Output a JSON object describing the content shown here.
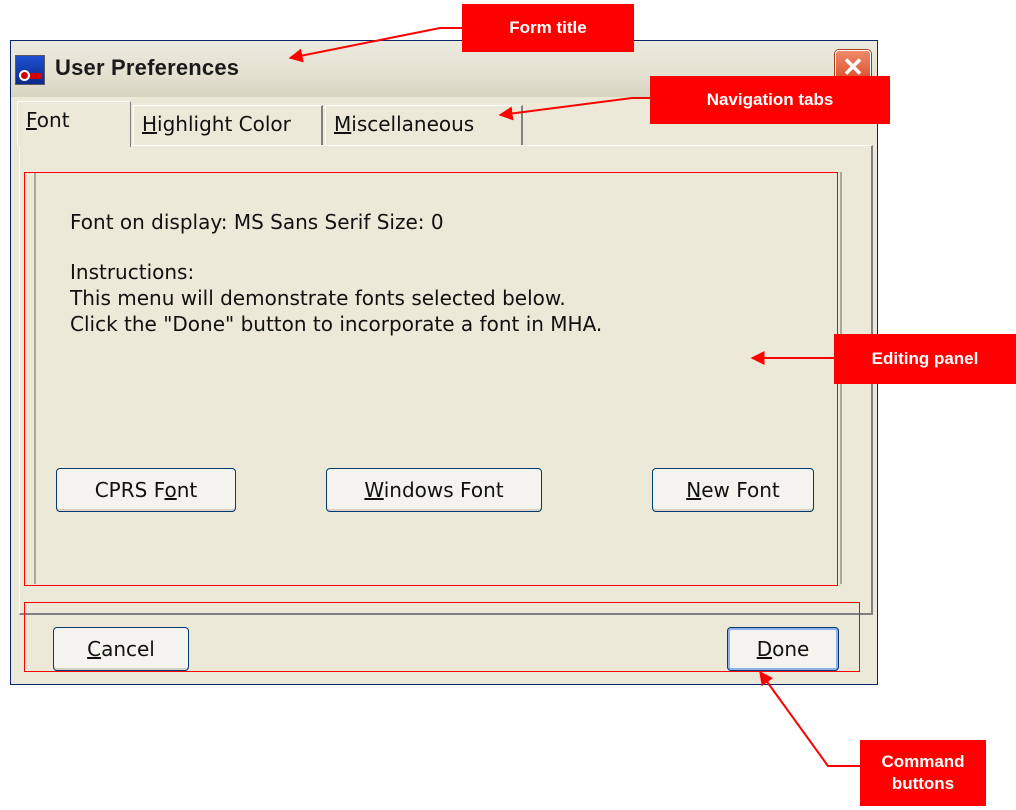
{
  "window": {
    "title": "User Preferences",
    "close_label": "✕"
  },
  "tabs": [
    {
      "pre": "",
      "u": "F",
      "post": "ont",
      "active": true
    },
    {
      "pre": "",
      "u": "H",
      "post": "ighlight Color",
      "active": false
    },
    {
      "pre": "",
      "u": "M",
      "post": "iscellaneous",
      "active": false
    }
  ],
  "panel": {
    "font_info": "Font on display: MS Sans Serif   Size: 0",
    "instructions_heading": "Instructions:",
    "instructions_line1": "This menu will demonstrate fonts selected below.",
    "instructions_line2": "Click the \"Done\" button to incorporate a font in MHA."
  },
  "font_buttons": {
    "cprs": {
      "pre": "CPRS F",
      "u": "o",
      "post": "nt"
    },
    "windows": {
      "pre": "",
      "u": "W",
      "post": "indows Font"
    },
    "new": {
      "pre": "",
      "u": "N",
      "post": "ew Font"
    }
  },
  "command_buttons": {
    "cancel": {
      "pre": "",
      "u": "C",
      "post": "ancel"
    },
    "done": {
      "pre": "",
      "u": "D",
      "post": "one"
    }
  },
  "annotations": {
    "form_title": "Form title",
    "navigation_tabs": "Navigation tabs",
    "editing_panel": "Editing panel",
    "command_buttons_line1": "Command",
    "command_buttons_line2": "buttons"
  },
  "colors": {
    "annotation_red": "#ff0000",
    "window_face": "#ece9d8",
    "close_button": "#d84a24"
  }
}
